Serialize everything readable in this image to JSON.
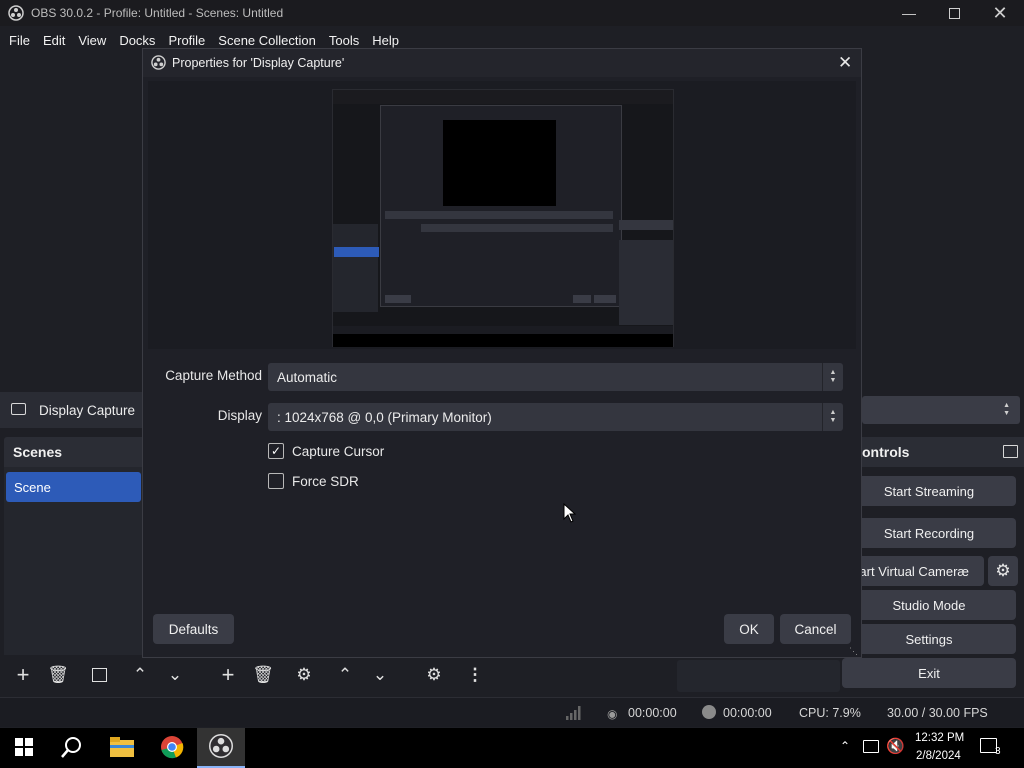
{
  "window": {
    "title": "OBS 30.0.2 - Profile: Untitled - Scenes: Untitled",
    "controls": [
      "minimize-icon",
      "maximize-icon",
      "close-icon"
    ]
  },
  "menubar": {
    "items": [
      "File",
      "Edit",
      "View",
      "Docks",
      "Profile",
      "Scene Collection",
      "Tools",
      "Help"
    ]
  },
  "sources": {
    "item_label": "Display Capture"
  },
  "scenes": {
    "header": "Scenes",
    "items": [
      "Scene"
    ]
  },
  "controls": {
    "header": "ontrols",
    "start_streaming": "Start Streaming",
    "start_recording": "Start Recording",
    "start_virtual_camera": "art Virtual Cameræ",
    "studio_mode": "Studio Mode",
    "settings": "Settings",
    "exit": "Exit"
  },
  "statusbar": {
    "stream_time": "00:00:00",
    "record_time": "00:00:00",
    "cpu": "CPU: 7.9%",
    "fps": "30.00 / 30.00 FPS"
  },
  "dialog": {
    "title": "Properties for 'Display Capture'",
    "capture_method_label": "Capture Method",
    "capture_method_value": "Automatic",
    "display_label": "Display",
    "display_value": ": 1024x768 @ 0,0 (Primary Monitor)",
    "capture_cursor_label": "Capture Cursor",
    "capture_cursor_checked": true,
    "force_sdr_label": "Force SDR",
    "force_sdr_checked": false,
    "defaults_button": "Defaults",
    "ok_button": "OK",
    "cancel_button": "Cancel"
  },
  "taskbar": {
    "time": "12:32 PM",
    "date": "2/8/2024",
    "notification_count": "3",
    "apps": [
      "windows-start-icon",
      "search-icon",
      "file-explorer-icon",
      "chrome-icon",
      "obs-icon"
    ]
  },
  "colors": {
    "accent": "#2d5bb8",
    "background": "#1e1f25",
    "button": "#3a3c46"
  }
}
